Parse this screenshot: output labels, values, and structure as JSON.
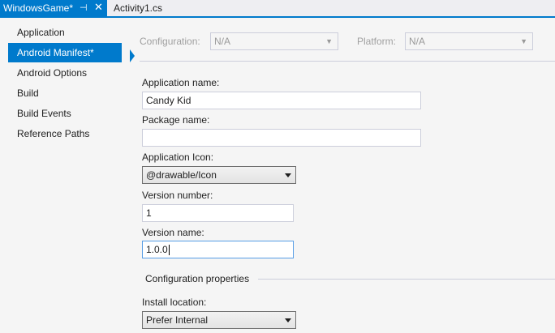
{
  "tabs": {
    "active_label": "WindowsGame*",
    "pin_glyph": "⊣",
    "close_glyph": "✕",
    "inactive_label": "Activity1.cs"
  },
  "sidebar": {
    "items": [
      {
        "label": "Application"
      },
      {
        "label": "Android Manifest*"
      },
      {
        "label": "Android Options"
      },
      {
        "label": "Build"
      },
      {
        "label": "Build Events"
      },
      {
        "label": "Reference Paths"
      }
    ],
    "active_index": 1
  },
  "config": {
    "configuration_label": "Configuration:",
    "configuration_value": "N/A",
    "platform_label": "Platform:",
    "platform_value": "N/A"
  },
  "form": {
    "app_name_label": "Application name:",
    "app_name_value": "Candy Kid",
    "package_name_label": "Package name:",
    "package_name_value": "",
    "app_icon_label": "Application Icon:",
    "app_icon_value": "@drawable/Icon",
    "version_number_label": "Version number:",
    "version_number_value": "1",
    "version_name_label": "Version name:",
    "version_name_value": "1.0.0",
    "config_props_title": "Configuration properties",
    "install_location_label": "Install location:",
    "install_location_value": "Prefer Internal"
  },
  "colors": {
    "accent": "#007acc",
    "background": "#f5f5f5"
  }
}
